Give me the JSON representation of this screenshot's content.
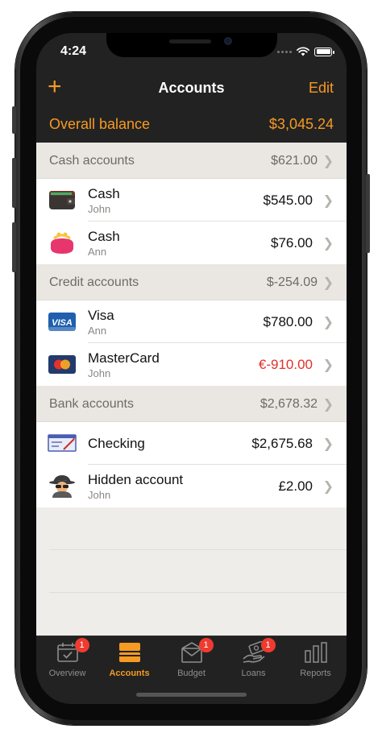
{
  "status_bar": {
    "time": "4:24"
  },
  "nav": {
    "add_label": "+",
    "title": "Accounts",
    "edit_label": "Edit"
  },
  "overall_balance": {
    "label": "Overall balance",
    "value": "$3,045.24"
  },
  "sections": [
    {
      "title": "Cash accounts",
      "total": "$621.00",
      "accounts": [
        {
          "name": "Cash",
          "owner": "John",
          "amount": "$545.00",
          "icon": "wallet-icon",
          "negative": false
        },
        {
          "name": "Cash",
          "owner": "Ann",
          "amount": "$76.00",
          "icon": "coin-purse-icon",
          "negative": false
        }
      ]
    },
    {
      "title": "Credit accounts",
      "total": "$-254.09",
      "accounts": [
        {
          "name": "Visa",
          "owner": "Ann",
          "amount": "$780.00",
          "icon": "visa-card-icon",
          "negative": false
        },
        {
          "name": "MasterCard",
          "owner": "John",
          "amount": "€-910.00",
          "icon": "mastercard-icon",
          "negative": true
        }
      ]
    },
    {
      "title": "Bank accounts",
      "total": "$2,678.32",
      "accounts": [
        {
          "name": "Checking",
          "owner": "",
          "amount": "$2,675.68",
          "icon": "check-icon",
          "negative": false
        },
        {
          "name": "Hidden account",
          "owner": "John",
          "amount": "£2.00",
          "icon": "spy-icon",
          "negative": false
        }
      ]
    }
  ],
  "tabs": [
    {
      "label": "Overview",
      "icon": "calendar-check-icon",
      "badge": "1",
      "active": false
    },
    {
      "label": "Accounts",
      "icon": "cards-icon",
      "badge": "",
      "active": true
    },
    {
      "label": "Budget",
      "icon": "envelope-icon",
      "badge": "1",
      "active": false
    },
    {
      "label": "Loans",
      "icon": "hand-money-icon",
      "badge": "1",
      "active": false
    },
    {
      "label": "Reports",
      "icon": "bar-chart-icon",
      "badge": "",
      "active": false
    }
  ],
  "colors": {
    "accent": "#f59a23",
    "negative": "#e0312a",
    "bar_background": "#222222",
    "badge": "#ef3b2f"
  }
}
